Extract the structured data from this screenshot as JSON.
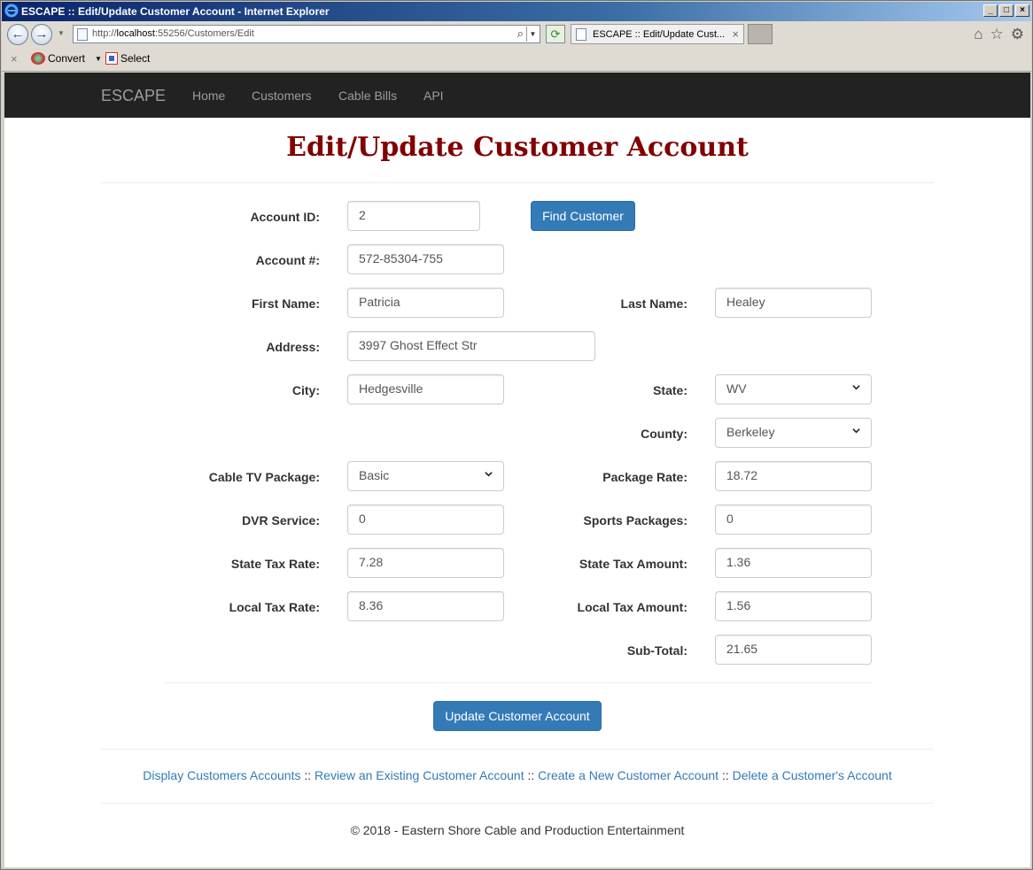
{
  "window": {
    "title": "ESCAPE :: Edit/Update Customer Account - Internet Explorer",
    "url_prefix": "http://",
    "url_host": "localhost",
    "url_rest": ":55256/Customers/Edit",
    "tab_label": "ESCAPE :: Edit/Update Cust...",
    "toolbar": {
      "convert_label": "Convert",
      "select_label": "Select"
    }
  },
  "navbar": {
    "brand": "ESCAPE",
    "links": [
      "Home",
      "Customers",
      "Cable Bills",
      "API"
    ]
  },
  "page": {
    "heading": "Edit/Update Customer Account",
    "find_button": "Find Customer",
    "update_button": "Update Customer Account"
  },
  "form": {
    "account_id": {
      "label": "Account ID:",
      "value": "2"
    },
    "account_number": {
      "label": "Account #:",
      "value": "572-85304-755"
    },
    "first_name": {
      "label": "First Name:",
      "value": "Patricia"
    },
    "last_name": {
      "label": "Last Name:",
      "value": "Healey"
    },
    "address": {
      "label": "Address:",
      "value": "3997 Ghost Effect Str"
    },
    "city": {
      "label": "City:",
      "value": "Hedgesville"
    },
    "state": {
      "label": "State:",
      "value": "WV"
    },
    "county": {
      "label": "County:",
      "value": "Berkeley"
    },
    "cable_package": {
      "label": "Cable TV Package:",
      "value": "Basic"
    },
    "package_rate": {
      "label": "Package Rate:",
      "value": "18.72"
    },
    "dvr_service": {
      "label": "DVR Service:",
      "value": "0"
    },
    "sports_packages": {
      "label": "Sports Packages:",
      "value": "0"
    },
    "state_tax_rate": {
      "label": "State Tax Rate:",
      "value": "7.28"
    },
    "state_tax_amount": {
      "label": "State Tax Amount:",
      "value": "1.36"
    },
    "local_tax_rate": {
      "label": "Local Tax Rate:",
      "value": "8.36"
    },
    "local_tax_amount": {
      "label": "Local Tax Amount:",
      "value": "1.56"
    },
    "sub_total": {
      "label": "Sub-Total:",
      "value": "21.65"
    }
  },
  "footer": {
    "links": [
      "Display Customers Accounts",
      "Review an Existing Customer Account",
      "Create a New Customer Account",
      "Delete a Customer's Account"
    ],
    "separator": " :: ",
    "copyright": "© 2018 - Eastern Shore Cable and Production Entertainment"
  },
  "colors": {
    "heading": "#800000",
    "navbar": "#222222",
    "button": "#337ab7",
    "link": "#337ab7"
  }
}
